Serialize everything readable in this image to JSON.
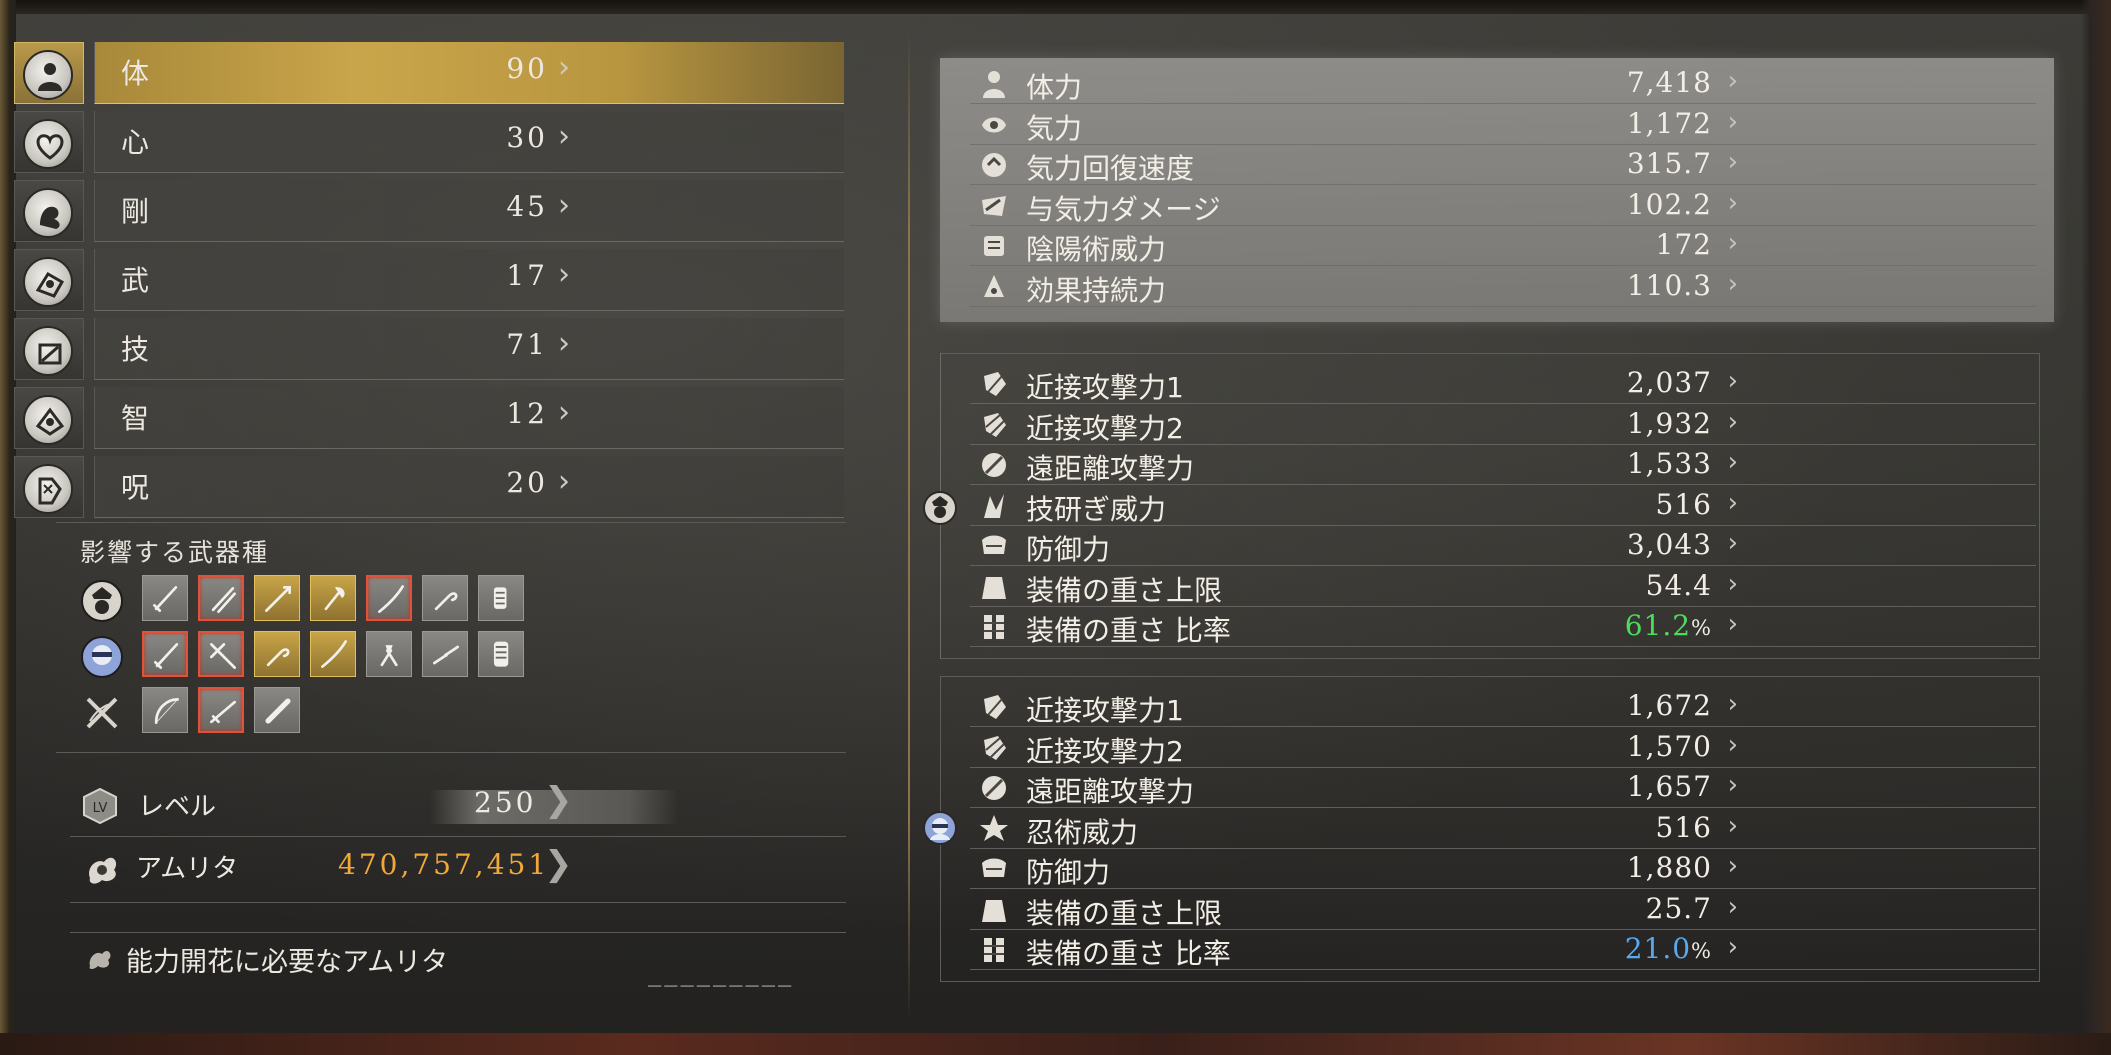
{
  "attributes": [
    {
      "name": "体",
      "value": "90",
      "icon": "body-icon",
      "active": true
    },
    {
      "name": "心",
      "value": "30",
      "icon": "heart-icon",
      "active": false
    },
    {
      "name": "剛",
      "value": "45",
      "icon": "strength-icon",
      "active": false
    },
    {
      "name": "武",
      "value": "17",
      "icon": "stamina-icon",
      "active": false
    },
    {
      "name": "技",
      "value": "71",
      "icon": "skill-icon",
      "active": false
    },
    {
      "name": "智",
      "value": "12",
      "icon": "dexterity-icon",
      "active": false
    },
    {
      "name": "呪",
      "value": "20",
      "icon": "magic-icon",
      "active": false
    }
  ],
  "weapons": {
    "title": "影響する武器種",
    "rows": [
      {
        "category_icon": "samurai-category-icon",
        "slots": [
          {
            "icon": "sword-icon",
            "state": "normal"
          },
          {
            "icon": "dual-swords-icon",
            "state": "red"
          },
          {
            "icon": "spear-icon",
            "state": "gold"
          },
          {
            "icon": "axe-icon",
            "state": "gold"
          },
          {
            "icon": "odachi-icon",
            "state": "red"
          },
          {
            "icon": "kusarigama-icon",
            "state": "normal"
          },
          {
            "icon": "tonfa-icon",
            "state": "normal"
          }
        ]
      },
      {
        "category_icon": "ninja-category-icon",
        "slots": [
          {
            "icon": "sword-icon",
            "state": "red"
          },
          {
            "icon": "switchglaive-icon",
            "state": "red"
          },
          {
            "icon": "kusarigama-icon",
            "state": "gold"
          },
          {
            "icon": "odachi-icon",
            "state": "gold"
          },
          {
            "icon": "hatchets-icon",
            "state": "normal"
          },
          {
            "icon": "splitstaff-icon",
            "state": "normal"
          },
          {
            "icon": "fists-icon",
            "state": "normal"
          }
        ]
      },
      {
        "category_icon": "ranged-category-icon",
        "slots": [
          {
            "icon": "bow-icon",
            "state": "normal"
          },
          {
            "icon": "rifle-icon",
            "state": "red"
          },
          {
            "icon": "cannon-icon",
            "state": "normal"
          }
        ]
      }
    ]
  },
  "level": {
    "label": "レベル",
    "value": "250"
  },
  "amrita": {
    "label": "アムリタ",
    "value": "470,757,451"
  },
  "bloom": {
    "label": "能力開花に必要なアムリタ",
    "value": "_________"
  },
  "general_stats": [
    {
      "icon": "life-icon",
      "label": "体力",
      "value": "7,418"
    },
    {
      "icon": "ki-icon",
      "label": "気力",
      "value": "1,172"
    },
    {
      "icon": "ki-recovery-icon",
      "label": "気力回復速度",
      "value": "315.7"
    },
    {
      "icon": "ki-damage-icon",
      "label": "与気力ダメージ",
      "value": "102.2"
    },
    {
      "icon": "onmyo-icon",
      "label": "陰陽術威力",
      "value": "172"
    },
    {
      "icon": "duration-icon",
      "label": "効果持続力",
      "value": "110.3"
    }
  ],
  "samurai_stats": [
    {
      "icon": "melee-icon",
      "label": "近接攻撃力1",
      "value": "2,037"
    },
    {
      "icon": "melee2-icon",
      "label": "近接攻撃力2",
      "value": "1,932"
    },
    {
      "icon": "ranged-icon",
      "label": "遠距離攻撃力",
      "value": "1,533"
    },
    {
      "icon": "martial-art-icon",
      "label": "技研ぎ威力",
      "value": "516"
    },
    {
      "icon": "defense-icon",
      "label": "防御力",
      "value": "3,043"
    },
    {
      "icon": "equip-weight-limit-icon",
      "label": "装備の重さ上限",
      "value": "54.4"
    },
    {
      "icon": "equip-weight-ratio-icon",
      "label": "装備の重さ 比率",
      "value": "61.2",
      "unit": "%",
      "color": "#4cdc5a"
    }
  ],
  "ninja_stats": [
    {
      "icon": "melee-icon",
      "label": "近接攻撃力1",
      "value": "1,672"
    },
    {
      "icon": "melee2-icon",
      "label": "近接攻撃力2",
      "value": "1,570"
    },
    {
      "icon": "ranged-icon",
      "label": "遠距離攻撃力",
      "value": "1,657"
    },
    {
      "icon": "ninjutsu-icon",
      "label": "忍術威力",
      "value": "516"
    },
    {
      "icon": "defense-icon",
      "label": "防御力",
      "value": "1,880"
    },
    {
      "icon": "equip-weight-limit-icon",
      "label": "装備の重さ上限",
      "value": "25.7"
    },
    {
      "icon": "equip-weight-ratio-icon",
      "label": "装備の重さ 比率",
      "value": "21.0",
      "unit": "%",
      "color": "#5aa8ee"
    }
  ],
  "colors": {
    "gold_accent": "#c9a54a",
    "amrita_orange": "#f0a838",
    "ratio_green": "#4cdc5a",
    "ratio_blue": "#5aa8ee",
    "slot_red": "#e2513a"
  }
}
